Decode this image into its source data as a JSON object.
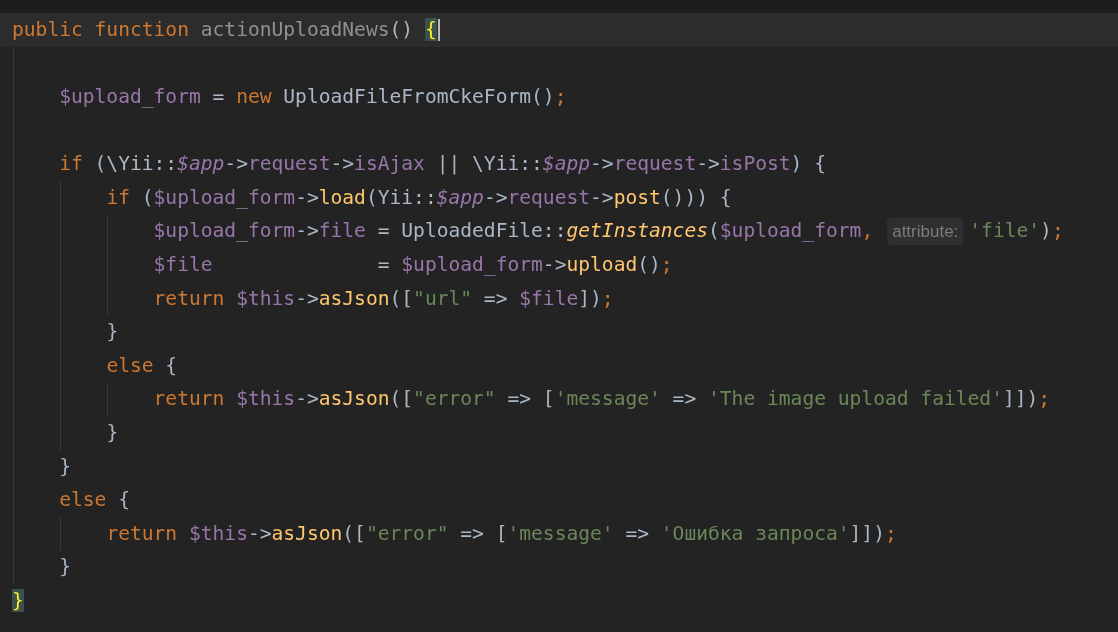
{
  "editor": {
    "lines": [
      {
        "current": true,
        "segments": [
          {
            "kind": "code",
            "tokens": [
              {
                "kind": "keyword",
                "t": "public function "
              },
              {
                "kind": "decl",
                "t": "actionUploadNews"
              },
              {
                "kind": "plain",
                "t": "() "
              },
              {
                "kind": "brace",
                "t": "{"
              }
            ]
          }
        ]
      },
      {
        "current": false
      },
      {
        "current": false,
        "segments": [
          {
            "kind": "code",
            "tokens": [
              {
                "kind": "var",
                "t": "    $upload_form"
              },
              {
                "kind": "plain",
                "t": " = "
              },
              {
                "kind": "keyword",
                "t": "new "
              },
              {
                "kind": "plain",
                "t": "UploadFileFromCkeForm()"
              },
              {
                "kind": "punct",
                "t": ";"
              }
            ]
          }
        ]
      },
      {
        "current": false
      },
      {
        "current": false,
        "segments": [
          {
            "kind": "code",
            "tokens": [
              {
                "kind": "keyword",
                "t": "    if "
              },
              {
                "kind": "plain",
                "t": "(\\Yii::"
              },
              {
                "kind": "var_italic",
                "t": "$app"
              },
              {
                "kind": "plain",
                "t": "->"
              },
              {
                "kind": "var",
                "t": "request"
              },
              {
                "kind": "plain",
                "t": "->"
              },
              {
                "kind": "var",
                "t": "isAjax"
              },
              {
                "kind": "plain",
                "t": " || \\Yii::"
              },
              {
                "kind": "var_italic",
                "t": "$app"
              },
              {
                "kind": "plain",
                "t": "->"
              },
              {
                "kind": "var",
                "t": "request"
              },
              {
                "kind": "plain",
                "t": "->"
              },
              {
                "kind": "var",
                "t": "isPost"
              },
              {
                "kind": "plain",
                "t": ") {"
              }
            ]
          }
        ]
      },
      {
        "current": false,
        "segments": [
          {
            "kind": "code",
            "tokens": [
              {
                "kind": "keyword",
                "t": "        if "
              },
              {
                "kind": "plain",
                "t": "("
              },
              {
                "kind": "var",
                "t": "$upload_form"
              },
              {
                "kind": "plain",
                "t": "->"
              },
              {
                "kind": "func",
                "t": "load"
              },
              {
                "kind": "plain",
                "t": "(Yii::"
              },
              {
                "kind": "var_italic",
                "t": "$app"
              },
              {
                "kind": "plain",
                "t": "->"
              },
              {
                "kind": "var",
                "t": "request"
              },
              {
                "kind": "plain",
                "t": "->"
              },
              {
                "kind": "func",
                "t": "post"
              },
              {
                "kind": "plain",
                "t": "())) {"
              }
            ]
          }
        ]
      },
      {
        "current": false,
        "segments": [
          {
            "kind": "code",
            "tokens": [
              {
                "kind": "var",
                "t": "            $upload_form"
              },
              {
                "kind": "plain",
                "t": "->"
              },
              {
                "kind": "var",
                "t": "file"
              },
              {
                "kind": "plain",
                "t": " = UploadedFile::"
              },
              {
                "kind": "func_italic",
                "t": "getInstances"
              },
              {
                "kind": "plain",
                "t": "("
              },
              {
                "kind": "var",
                "t": "$upload_form"
              },
              {
                "kind": "punct",
                "t": ","
              }
            ]
          },
          {
            "kind": "hint",
            "text": "attribute:"
          },
          {
            "kind": "code",
            "tokens": [
              {
                "kind": "string",
                "t": "'file'"
              },
              {
                "kind": "plain",
                "t": ")"
              },
              {
                "kind": "punct",
                "t": ";"
              }
            ]
          }
        ]
      },
      {
        "current": false,
        "segments": [
          {
            "kind": "code",
            "tokens": [
              {
                "kind": "var",
                "t": "            $file"
              },
              {
                "kind": "plain",
                "t": "              = "
              },
              {
                "kind": "var",
                "t": "$upload_form"
              },
              {
                "kind": "plain",
                "t": "->"
              },
              {
                "kind": "func",
                "t": "upload"
              },
              {
                "kind": "plain",
                "t": "()"
              },
              {
                "kind": "punct",
                "t": ";"
              }
            ]
          }
        ]
      },
      {
        "current": false,
        "segments": [
          {
            "kind": "code",
            "tokens": [
              {
                "kind": "keyword",
                "t": "            return "
              },
              {
                "kind": "var",
                "t": "$this"
              },
              {
                "kind": "plain",
                "t": "->"
              },
              {
                "kind": "func",
                "t": "asJson"
              },
              {
                "kind": "plain",
                "t": "(["
              },
              {
                "kind": "string",
                "t": "\"url\""
              },
              {
                "kind": "plain",
                "t": " => "
              },
              {
                "kind": "var",
                "t": "$file"
              },
              {
                "kind": "plain",
                "t": "])"
              },
              {
                "kind": "punct",
                "t": ";"
              }
            ]
          }
        ]
      },
      {
        "current": false,
        "segments": [
          {
            "kind": "code",
            "tokens": [
              {
                "kind": "plain",
                "t": "        }"
              }
            ]
          }
        ]
      },
      {
        "current": false,
        "segments": [
          {
            "kind": "code",
            "tokens": [
              {
                "kind": "keyword",
                "t": "        else "
              },
              {
                "kind": "plain",
                "t": "{"
              }
            ]
          }
        ]
      },
      {
        "current": false,
        "segments": [
          {
            "kind": "code",
            "tokens": [
              {
                "kind": "keyword",
                "t": "            return "
              },
              {
                "kind": "var",
                "t": "$this"
              },
              {
                "kind": "plain",
                "t": "->"
              },
              {
                "kind": "func",
                "t": "asJson"
              },
              {
                "kind": "plain",
                "t": "(["
              },
              {
                "kind": "string",
                "t": "\"error\""
              },
              {
                "kind": "plain",
                "t": " => ["
              },
              {
                "kind": "string",
                "t": "'message'"
              },
              {
                "kind": "plain",
                "t": " => "
              },
              {
                "kind": "string",
                "t": "'The image upload failed'"
              },
              {
                "kind": "plain",
                "t": "]])"
              },
              {
                "kind": "punct",
                "t": ";"
              }
            ]
          }
        ]
      },
      {
        "current": false,
        "segments": [
          {
            "kind": "code",
            "tokens": [
              {
                "kind": "plain",
                "t": "        }"
              }
            ]
          }
        ]
      },
      {
        "current": false,
        "segments": [
          {
            "kind": "code",
            "tokens": [
              {
                "kind": "plain",
                "t": "    }"
              }
            ]
          }
        ]
      },
      {
        "current": false,
        "segments": [
          {
            "kind": "code",
            "tokens": [
              {
                "kind": "keyword",
                "t": "    else "
              },
              {
                "kind": "plain",
                "t": "{"
              }
            ]
          }
        ]
      },
      {
        "current": false,
        "segments": [
          {
            "kind": "code",
            "tokens": [
              {
                "kind": "keyword",
                "t": "        return "
              },
              {
                "kind": "var",
                "t": "$this"
              },
              {
                "kind": "plain",
                "t": "->"
              },
              {
                "kind": "func",
                "t": "asJson"
              },
              {
                "kind": "plain",
                "t": "(["
              },
              {
                "kind": "string",
                "t": "\"error\""
              },
              {
                "kind": "plain",
                "t": " => ["
              },
              {
                "kind": "string",
                "t": "'message'"
              },
              {
                "kind": "plain",
                "t": " => "
              },
              {
                "kind": "string",
                "t": "'Ошибка запроса'"
              },
              {
                "kind": "plain",
                "t": "]])"
              },
              {
                "kind": "punct",
                "t": ";"
              }
            ]
          }
        ]
      },
      {
        "current": false,
        "segments": [
          {
            "kind": "code",
            "tokens": [
              {
                "kind": "plain",
                "t": "    }"
              }
            ]
          }
        ]
      },
      {
        "current": false,
        "segments": [
          {
            "kind": "code",
            "tokens": [
              {
                "kind": "brace",
                "t": "}"
              }
            ]
          }
        ]
      }
    ]
  }
}
